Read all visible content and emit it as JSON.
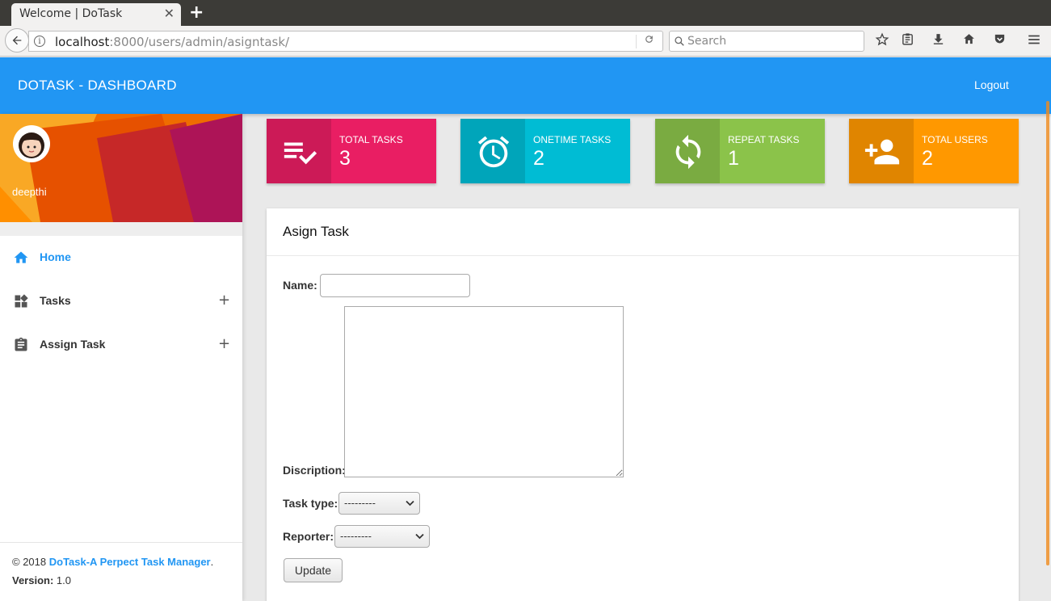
{
  "browser": {
    "tab_title": "Welcome | DoTask",
    "tab_close": "✕",
    "new_tab": "+",
    "url_host": "localhost",
    "url_rest": ":8000/users/admin/asigntask/",
    "search_placeholder": "Search"
  },
  "header": {
    "title": "DOTASK - DASHBOARD",
    "logout": "Logout"
  },
  "sidebar": {
    "username": "deepthi",
    "items": [
      {
        "label": "Home",
        "icon": "home-icon",
        "active": true
      },
      {
        "label": "Tasks",
        "icon": "widgets-icon",
        "expand": "+"
      },
      {
        "label": "Assign Task",
        "icon": "clipboard-icon",
        "expand": "+"
      }
    ],
    "footer": {
      "copyright": "© 2018 ",
      "link": "DoTask-A Perpect Task Manager",
      "period": ".",
      "version_label": "Version:",
      "version": " 1.0"
    }
  },
  "stats": [
    {
      "label": "TOTAL TASKS",
      "value": "3",
      "color": "#e91e63",
      "icon": "playlist-check-icon"
    },
    {
      "label": "ONETIME TASKS",
      "value": "2",
      "color": "#00bcd4",
      "icon": "alarm-icon"
    },
    {
      "label": "REPEAT TASKS",
      "value": "1",
      "color": "#8bc34a",
      "icon": "refresh-icon"
    },
    {
      "label": "TOTAL USERS",
      "value": "2",
      "color": "#ff9800",
      "icon": "person-add-icon"
    }
  ],
  "form": {
    "title": "Asign Task",
    "name_label": "Name:",
    "name_value": "",
    "description_label": "Discription:",
    "task_type_label": "Task type:",
    "task_type_value": "---------",
    "reporter_label": "Reporter:",
    "reporter_value": "---------",
    "update_label": "Update"
  },
  "colors": {
    "primary": "#2196f3"
  }
}
